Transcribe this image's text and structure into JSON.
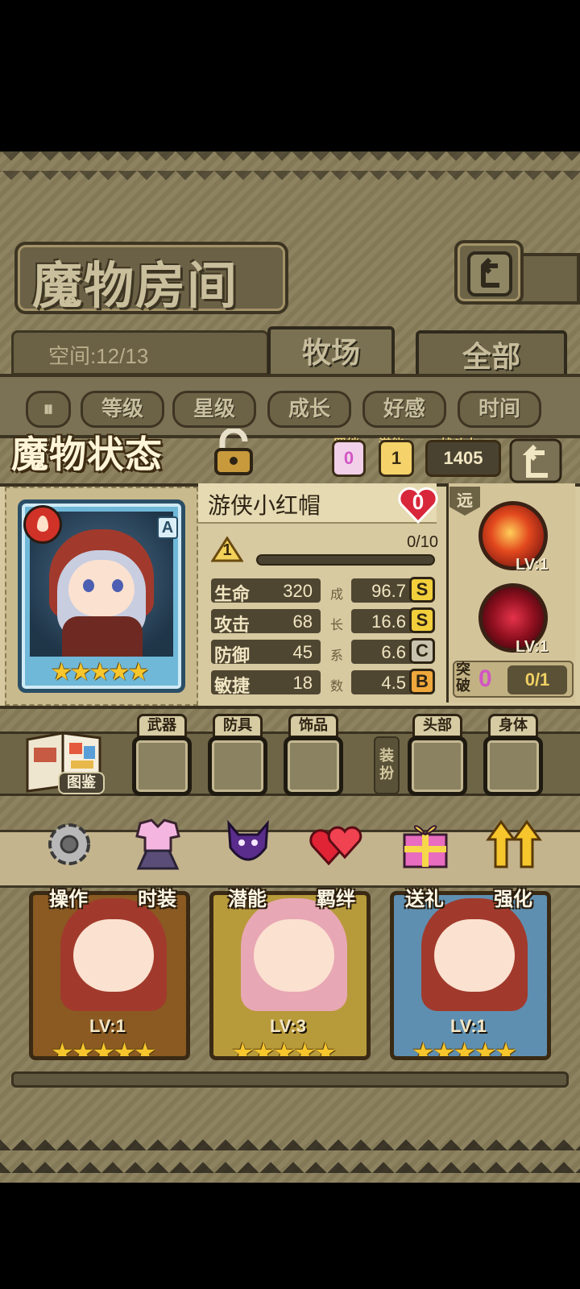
{
  "header": {
    "title": "魔物房间"
  },
  "space": {
    "label": "空间:12/13"
  },
  "tabs": [
    {
      "label": "牧场"
    },
    {
      "label": "全部"
    }
  ],
  "sort": [
    {
      "label": "等级"
    },
    {
      "label": "星级"
    },
    {
      "label": "成长"
    },
    {
      "label": "好感"
    },
    {
      "label": "时间"
    }
  ],
  "status": {
    "title": "魔物状态",
    "bond_label": "羁绊",
    "bond_value": "0",
    "potential_label": "潜能",
    "potential_value": "1",
    "power_label": "战斗力",
    "power_value": "1405",
    "monster": {
      "name": "游侠小红帽",
      "affection": "0",
      "rank": "A",
      "stars": "★★★★★",
      "level": "1",
      "exp_text": "0/10",
      "exp_progress": 0.0
    },
    "stats": [
      {
        "label": "生命",
        "value": "320",
        "growth": "96.7",
        "grade": "S"
      },
      {
        "label": "攻击",
        "value": "68",
        "growth": "16.6",
        "grade": "S"
      },
      {
        "label": "防御",
        "value": "45",
        "growth": "6.6",
        "grade": "C"
      },
      {
        "label": "敏捷",
        "value": "18",
        "growth": "4.5",
        "grade": "B"
      }
    ],
    "growth_vertical": [
      "成",
      "长",
      "系",
      "数"
    ],
    "range_tag": "远",
    "skills": [
      {
        "level": "LV:1"
      },
      {
        "level": "LV:1"
      }
    ],
    "breakthrough": {
      "label": "突破",
      "value": "0",
      "progress": "0/1"
    }
  },
  "equipment": {
    "codex_label": "图鉴",
    "equip_button": "装扮",
    "slots": [
      {
        "label": "武器"
      },
      {
        "label": "防具"
      },
      {
        "label": "饰品"
      },
      {
        "label": "头部"
      },
      {
        "label": "身体"
      }
    ]
  },
  "actions": [
    {
      "label": "操作",
      "icon": "gear-icon"
    },
    {
      "label": "时装",
      "icon": "outfit-icon"
    },
    {
      "label": "潜能",
      "icon": "shadow-demon-icon"
    },
    {
      "label": "羁绊",
      "icon": "hearts-icon"
    },
    {
      "label": "送礼",
      "icon": "gift-icon"
    },
    {
      "label": "强化",
      "icon": "up-arrows-icon"
    }
  ],
  "monsters": [
    {
      "level": "LV:1",
      "stars": "★★★★★"
    },
    {
      "level": "LV:3",
      "stars": "★★★★★"
    },
    {
      "level": "LV:1",
      "stars": "★★★★★"
    }
  ],
  "colors": {
    "grade_S": "#f2cf3b",
    "grade_C": "#c9c2ad",
    "grade_B": "#f0a83c",
    "bond_pink": "#d255c5"
  }
}
